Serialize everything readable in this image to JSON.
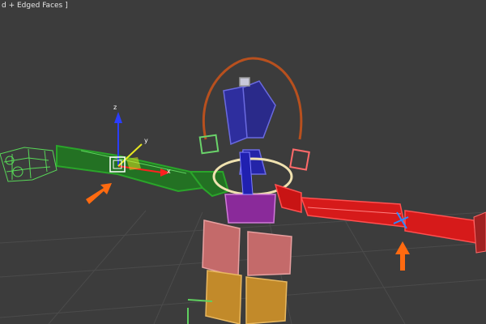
{
  "viewport": {
    "label": "d + Edged Faces ]",
    "background": "#3c3c3c",
    "grid_color": "#4a4a4a"
  },
  "rig": {
    "left_arm_color": "#2aa52a",
    "right_arm_color": "#e01818",
    "spine_color": "#2e2e9e",
    "pelvis_color": "#9b2fa6",
    "leg_upper_color": "#d07a7a",
    "leg_lower_color": "#c89a3a",
    "rotate_ring_color": "#b8501e",
    "hip_ring_color": "#f0e2b0",
    "arrow_color": "#ff6a10"
  },
  "gizmo": {
    "axis_x_label": "x",
    "axis_y_label": "y",
    "axis_z_label": "z"
  },
  "icons": [
    "move-gizmo-icon",
    "indicator-arrow-icon"
  ]
}
